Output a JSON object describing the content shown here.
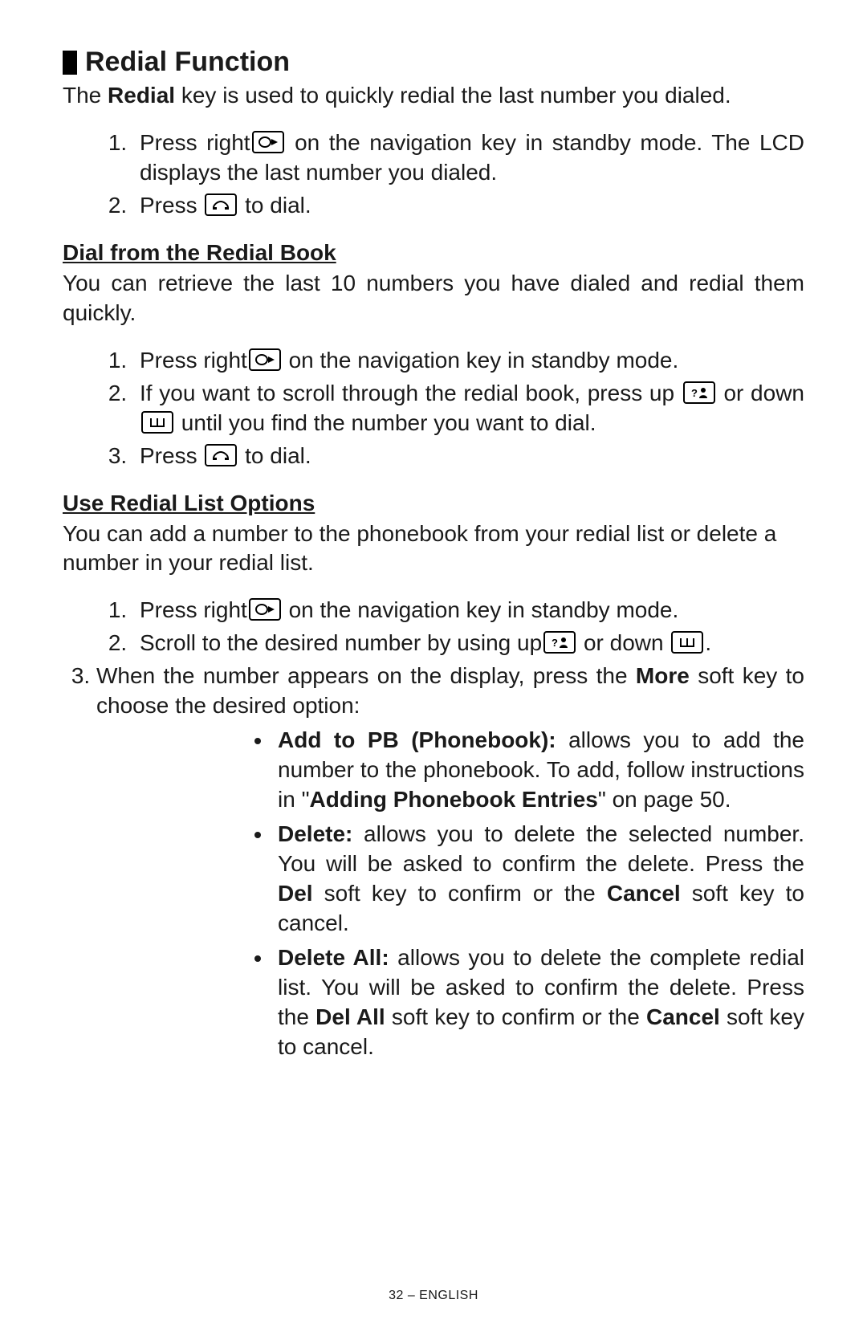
{
  "section": {
    "title": "Redial Function",
    "intro_pre": "The ",
    "intro_bold": "Redial",
    "intro_post": " key is used to quickly redial the last number you dialed.",
    "steps1": {
      "s1_pre": "Press right",
      "s1_post": " on the navigation key in standby mode. The LCD displays the last number you dialed.",
      "s2_pre": "Press ",
      "s2_post": " to dial."
    },
    "sub1": {
      "title": "Dial from the Redial Book",
      "intro": "You can retrieve the last 10 numbers you have dialed and redial them quickly.",
      "s1_pre": "Press right",
      "s1_post": " on the navigation key in standby mode.",
      "s2_pre": "If you want to scroll through the redial book, press up ",
      "s2_mid": " or down",
      "s2_post": " until you find the number you want to dial.",
      "s3_pre": "Press ",
      "s3_post": " to dial."
    },
    "sub2": {
      "title": "Use Redial List Options",
      "intro": "You can add a number to the phonebook from your redial list or delete a number in your redial list.",
      "s1_pre": "Press right",
      "s1_post": " on the navigation key in standby mode.",
      "s2_pre": "Scroll to the desired number by using up",
      "s2_mid": " or down ",
      "s2_post": ".",
      "s3_pre": "When the number appears on the display, press the ",
      "s3_bold": "More",
      "s3_post": " soft key to choose the desired option:",
      "bullets": {
        "b1_bold": "Add to PB (Phonebook):",
        "b1_a": " allows you to add the number to the phonebook.  To add, follow instructions in \"",
        "b1_ref": "Adding Phonebook Entries",
        "b1_b": "\" on page 50.",
        "b2_bold": "Delete:",
        "b2_a": " allows you to delete the selected number.  You will be asked to confirm the delete.  Press the ",
        "b2_del": "Del",
        "b2_b": " soft key to confirm or the ",
        "b2_cancel": "Cancel",
        "b2_c": " soft key to cancel.",
        "b3_bold": "Delete All:",
        "b3_a": " allows you to delete the complete redial list.  You will be asked to confirm the delete.  Press the ",
        "b3_del": "Del All",
        "b3_b": " soft key to confirm or the ",
        "b3_cancel": "Cancel",
        "b3_c": " soft key to cancel."
      }
    }
  },
  "footer": "32 – ENGLISH"
}
